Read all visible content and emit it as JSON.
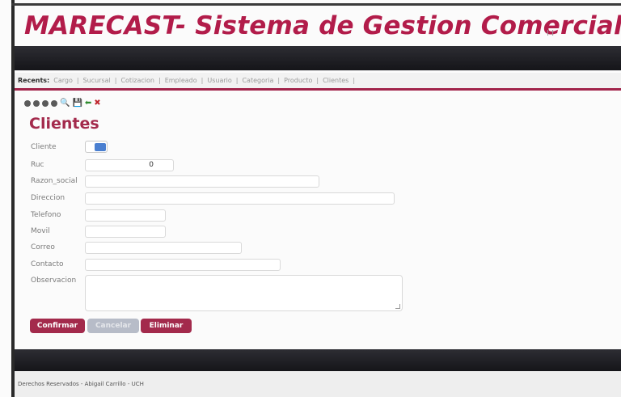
{
  "app": {
    "title": "MARECAST- Sistema de Gestion Comercial",
    "title_mark": "I I"
  },
  "recents": {
    "label": "Recents:",
    "items": [
      "Cargo",
      "Sucursal",
      "Cotizacion",
      "Empleado",
      "Usuario",
      "Categoria",
      "Producto",
      "Clientes"
    ],
    "separator": "|"
  },
  "toolbar": {
    "icons": [
      "first-record-icon",
      "previous-record-icon",
      "next-record-icon",
      "last-record-icon",
      "search-icon",
      "save-icon",
      "back-arrow-icon",
      "close-icon"
    ],
    "search_glyph": "🔍",
    "save_glyph": "💾",
    "back_glyph": "⬅",
    "close_glyph": "✖",
    "back_color": "#2e8b2e",
    "close_color": "#c0282f"
  },
  "page": {
    "title": "Clientes"
  },
  "form": {
    "cliente_label": "Cliente",
    "ruc_label": "Ruc",
    "ruc_value": "0",
    "razon_social_label": "Razon_social",
    "direccion_label": "Direccion",
    "telefono_label": "Telefono",
    "movil_label": "Movil",
    "correo_label": "Correo",
    "contacto_label": "Contacto",
    "observacion_label": "Observacion"
  },
  "buttons": {
    "confirm": "Confirmar",
    "cancel": "Cancelar",
    "delete": "Eliminar"
  },
  "footer": {
    "text": "Derechos Reservados - Abigail Carrillo - UCH"
  },
  "colors": {
    "accent": "#a32a4c",
    "title": "#b21c4a",
    "dark_bar": "#1c1c22"
  }
}
